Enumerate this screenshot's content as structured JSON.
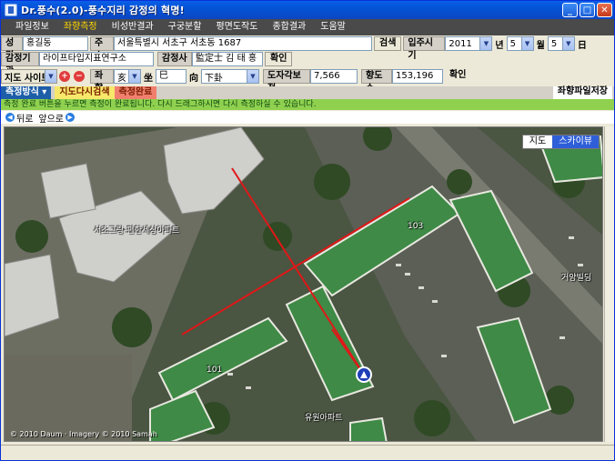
{
  "window": {
    "title": "Dr.풍수(2.0)-풍수지리 감정의 혁명!"
  },
  "menu": {
    "items": [
      "파일정보",
      "좌향측정",
      "비성반결과",
      "구궁분할",
      "평면도작도",
      "종합결과",
      "도움말"
    ],
    "active_index": 1
  },
  "row1": {
    "name_label": "성명",
    "name_value": "홍길동",
    "address_label": "주소",
    "address_value": "서울특별시 서초구 서초동 1687",
    "search_button": "검색",
    "move_in_label": "입주시기",
    "year_value": "2011",
    "year_unit": "년",
    "month_value": "5",
    "month_unit": "월",
    "day_value": "5",
    "day_unit": "日"
  },
  "row2": {
    "org_label": "감정기관",
    "org_value": "라이프타입지표연구소",
    "appraiser_label": "감정사",
    "appraiser_value": "監定士 김 태 홍",
    "confirm_button": "확인"
  },
  "row3": {
    "map_site_label": "지도 사이트",
    "zwa_label": "좌향",
    "zwa_value": "亥",
    "zwa_suffix": "坐",
    "si_value": "巳",
    "hyang_label": "向",
    "hyang_value": "下卦",
    "declination_label": "도자각보정",
    "declination_value": "7,566",
    "hyangdo_label": "향도수",
    "hyangdo_value": "153,196",
    "confirm_button": "확인"
  },
  "row4": {
    "method_label": "측정방식",
    "redraw_button": "지도다시검색",
    "complete_button": "측정완료",
    "save_button": "좌향파일저장"
  },
  "notice": "측정 완료 버튼을 누르면 측정이 완료됩니다. 다시 드래그하시면 다시 측정하실 수 있습니다.",
  "nav": {
    "back": "뒤로",
    "forward": "앞으로"
  },
  "map": {
    "tabs": [
      "지도",
      "스카이뷰"
    ],
    "active_tab": 1,
    "labels": [
      {
        "text": "서초그랑-편한세상아파트",
        "key": "apt1"
      },
      {
        "text": "거양빌딩",
        "key": "bldg"
      },
      {
        "text": "유원아파트",
        "key": "apt2"
      },
      {
        "text": "103",
        "key": "n103"
      },
      {
        "text": "101",
        "key": "n101"
      }
    ],
    "copyright": "© 2010 Daum · Imagery © 2010 Samah",
    "compass_lines_color": "#e01818"
  }
}
